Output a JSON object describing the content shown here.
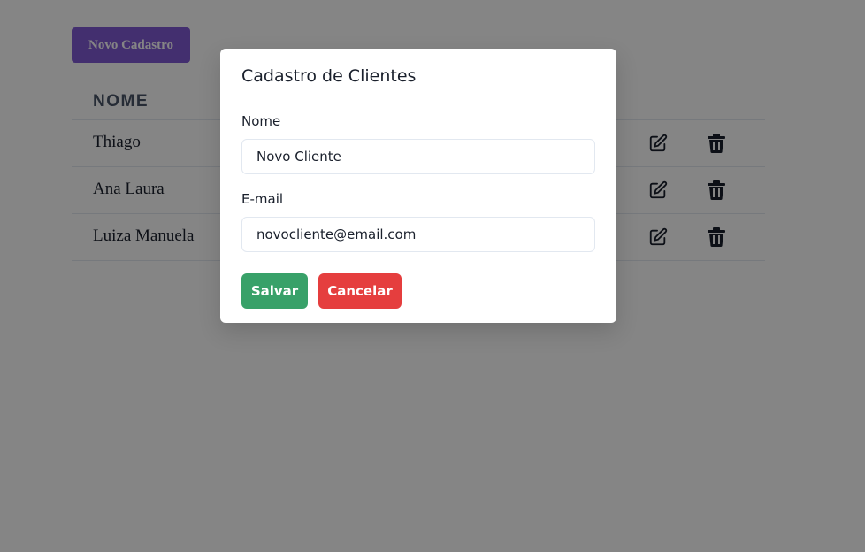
{
  "toolbar": {
    "new_button_label": "Novo Cadastro"
  },
  "table": {
    "header": "NOME",
    "rows": [
      {
        "name": "Thiago"
      },
      {
        "name": "Ana Laura"
      },
      {
        "name": "Luiza Manuela"
      }
    ]
  },
  "modal": {
    "title": "Cadastro de Clientes",
    "name_label": "Nome",
    "name_value": "Novo Cliente",
    "email_label": "E-mail",
    "email_value": "novocliente@email.com",
    "save_label": "Salvar",
    "cancel_label": "Cancelar"
  },
  "colors": {
    "primary": "#805ad5",
    "save": "#38a169",
    "cancel": "#e53e3e",
    "overlay": "rgba(0,0,0,0.48)"
  },
  "icons": {
    "edit": "edit-icon",
    "delete": "trash-icon"
  }
}
